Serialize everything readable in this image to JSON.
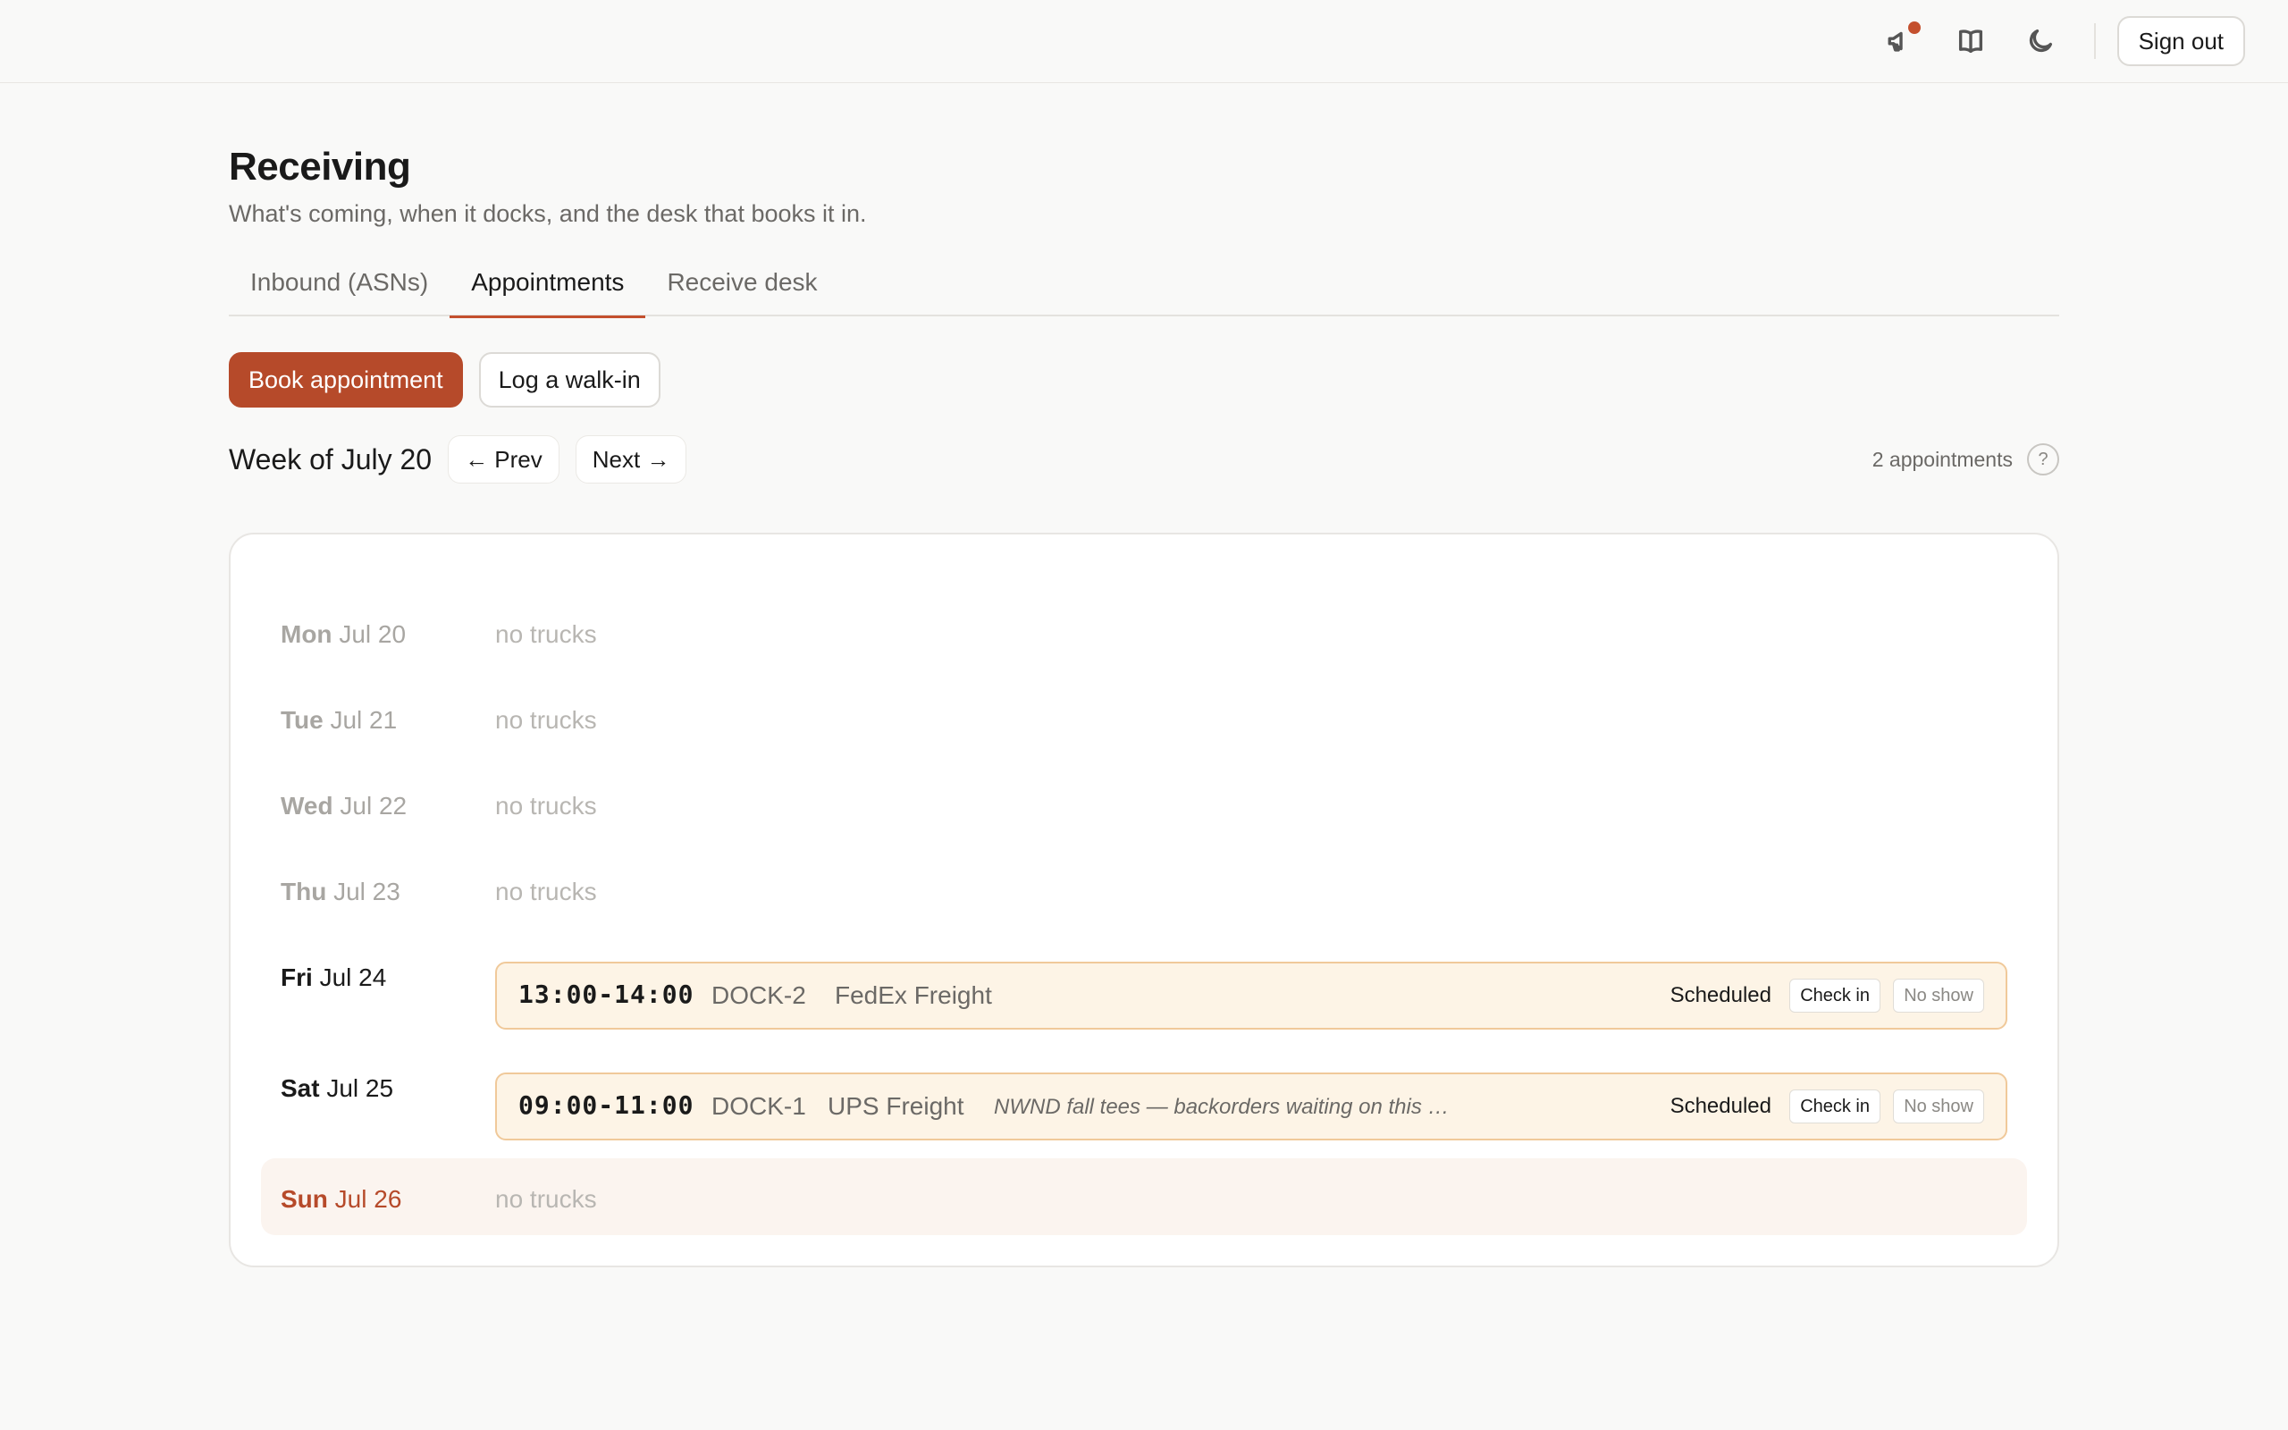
{
  "topbar": {
    "icons": [
      "megaphone-icon",
      "book-icon",
      "moon-icon"
    ],
    "sign_out_label": "Sign out"
  },
  "page": {
    "title": "Receiving",
    "subtitle": "What's coming, when it docks, and the desk that books it in."
  },
  "tabs": [
    {
      "label": "Inbound (ASNs)",
      "active": false
    },
    {
      "label": "Appointments",
      "active": true
    },
    {
      "label": "Receive desk",
      "active": false
    }
  ],
  "actions": {
    "book_label": "Book appointment",
    "walkin_label": "Log a walk-in"
  },
  "week": {
    "title": "Week of July 20",
    "prev_label": "← Prev",
    "next_label": "Next →",
    "count_label": "2 appointments",
    "help_label": "?"
  },
  "days": [
    {
      "dow": "Mon",
      "date": "Jul 20",
      "empty_text": "no trucks"
    },
    {
      "dow": "Tue",
      "date": "Jul 21",
      "empty_text": "no trucks"
    },
    {
      "dow": "Wed",
      "date": "Jul 22",
      "empty_text": "no trucks"
    },
    {
      "dow": "Thu",
      "date": "Jul 23",
      "empty_text": "no trucks"
    },
    {
      "dow": "Fri",
      "date": "Jul 24",
      "appointment": {
        "time": "13:00-14:00",
        "dock": "DOCK-2",
        "carrier": "FedEx Freight",
        "note": "",
        "status": "Scheduled",
        "checkin_label": "Check in",
        "noshow_label": "No show"
      }
    },
    {
      "dow": "Sat",
      "date": "Jul 25",
      "appointment": {
        "time": "09:00-11:00",
        "dock": "DOCK-1",
        "carrier": "UPS Freight",
        "note": "NWND fall tees — backorders waiting on this …",
        "status": "Scheduled",
        "checkin_label": "Check in",
        "noshow_label": "No show"
      }
    },
    {
      "dow": "Sun",
      "date": "Jul 26",
      "empty_text": "no trucks",
      "today": true
    }
  ],
  "colors": {
    "accent": "#b64a2a",
    "appointment_bg": "#fdf4e6",
    "appointment_border": "#f0c99a",
    "today_bg": "#fbf4ef"
  }
}
